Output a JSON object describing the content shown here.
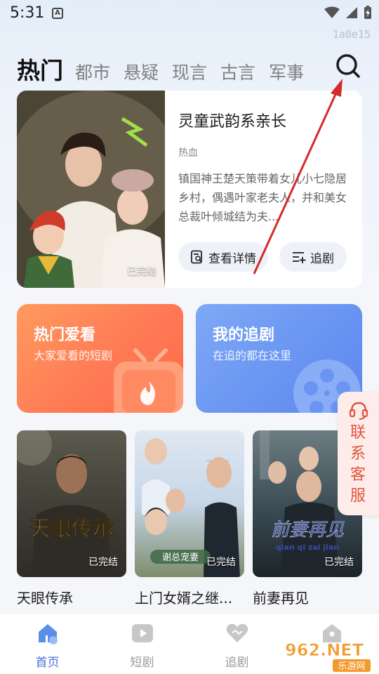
{
  "status_bar": {
    "time": "5:31",
    "notif_letter": "A"
  },
  "watermark_id": "1a0e15",
  "tabs": [
    {
      "label": "热门",
      "active": true
    },
    {
      "label": "都市"
    },
    {
      "label": "悬疑"
    },
    {
      "label": "现言"
    },
    {
      "label": "古言"
    },
    {
      "label": "军事"
    }
  ],
  "featured": {
    "title": "灵童武韵系亲长",
    "genre": "热血",
    "description": "镇国神王楚天策带着女儿小七隐居乡村，偶遇叶家老夫人，并和美女总裁叶倾城结为夫...",
    "badge": "已完结",
    "detail_label": "查看详情",
    "follow_label": "追剧"
  },
  "promos": [
    {
      "title": "热门爱看",
      "subtitle": "大家爱看的短剧"
    },
    {
      "title": "我的追剧",
      "subtitle": "在追的都在这里"
    }
  ],
  "customer_service": {
    "label": "联系客服"
  },
  "dramas": [
    {
      "title": "天眼传承",
      "badge": "已完结",
      "poster_text": "天眼传承"
    },
    {
      "title": "上门女婿之继...",
      "badge": "已完结",
      "poster_text": "谢总宠妻"
    },
    {
      "title": "前妻再见",
      "badge": "已完结",
      "poster_text": "前妻再见",
      "poster_sub": "qian qi zai jian"
    }
  ],
  "bottom_nav": [
    {
      "label": "首页",
      "icon": "home-icon",
      "active": true
    },
    {
      "label": "短剧",
      "icon": "play-icon"
    },
    {
      "label": "追剧",
      "icon": "heart-icon"
    },
    {
      "label": "",
      "icon": "profile-icon"
    }
  ],
  "watermark": {
    "text": "962.NET",
    "sub": "乐游网"
  },
  "colors": {
    "accent": "#4a6ddb",
    "promo_hot": "#ff7a55",
    "promo_follow": "#6a95f2",
    "arrow": "#d42a2a"
  }
}
